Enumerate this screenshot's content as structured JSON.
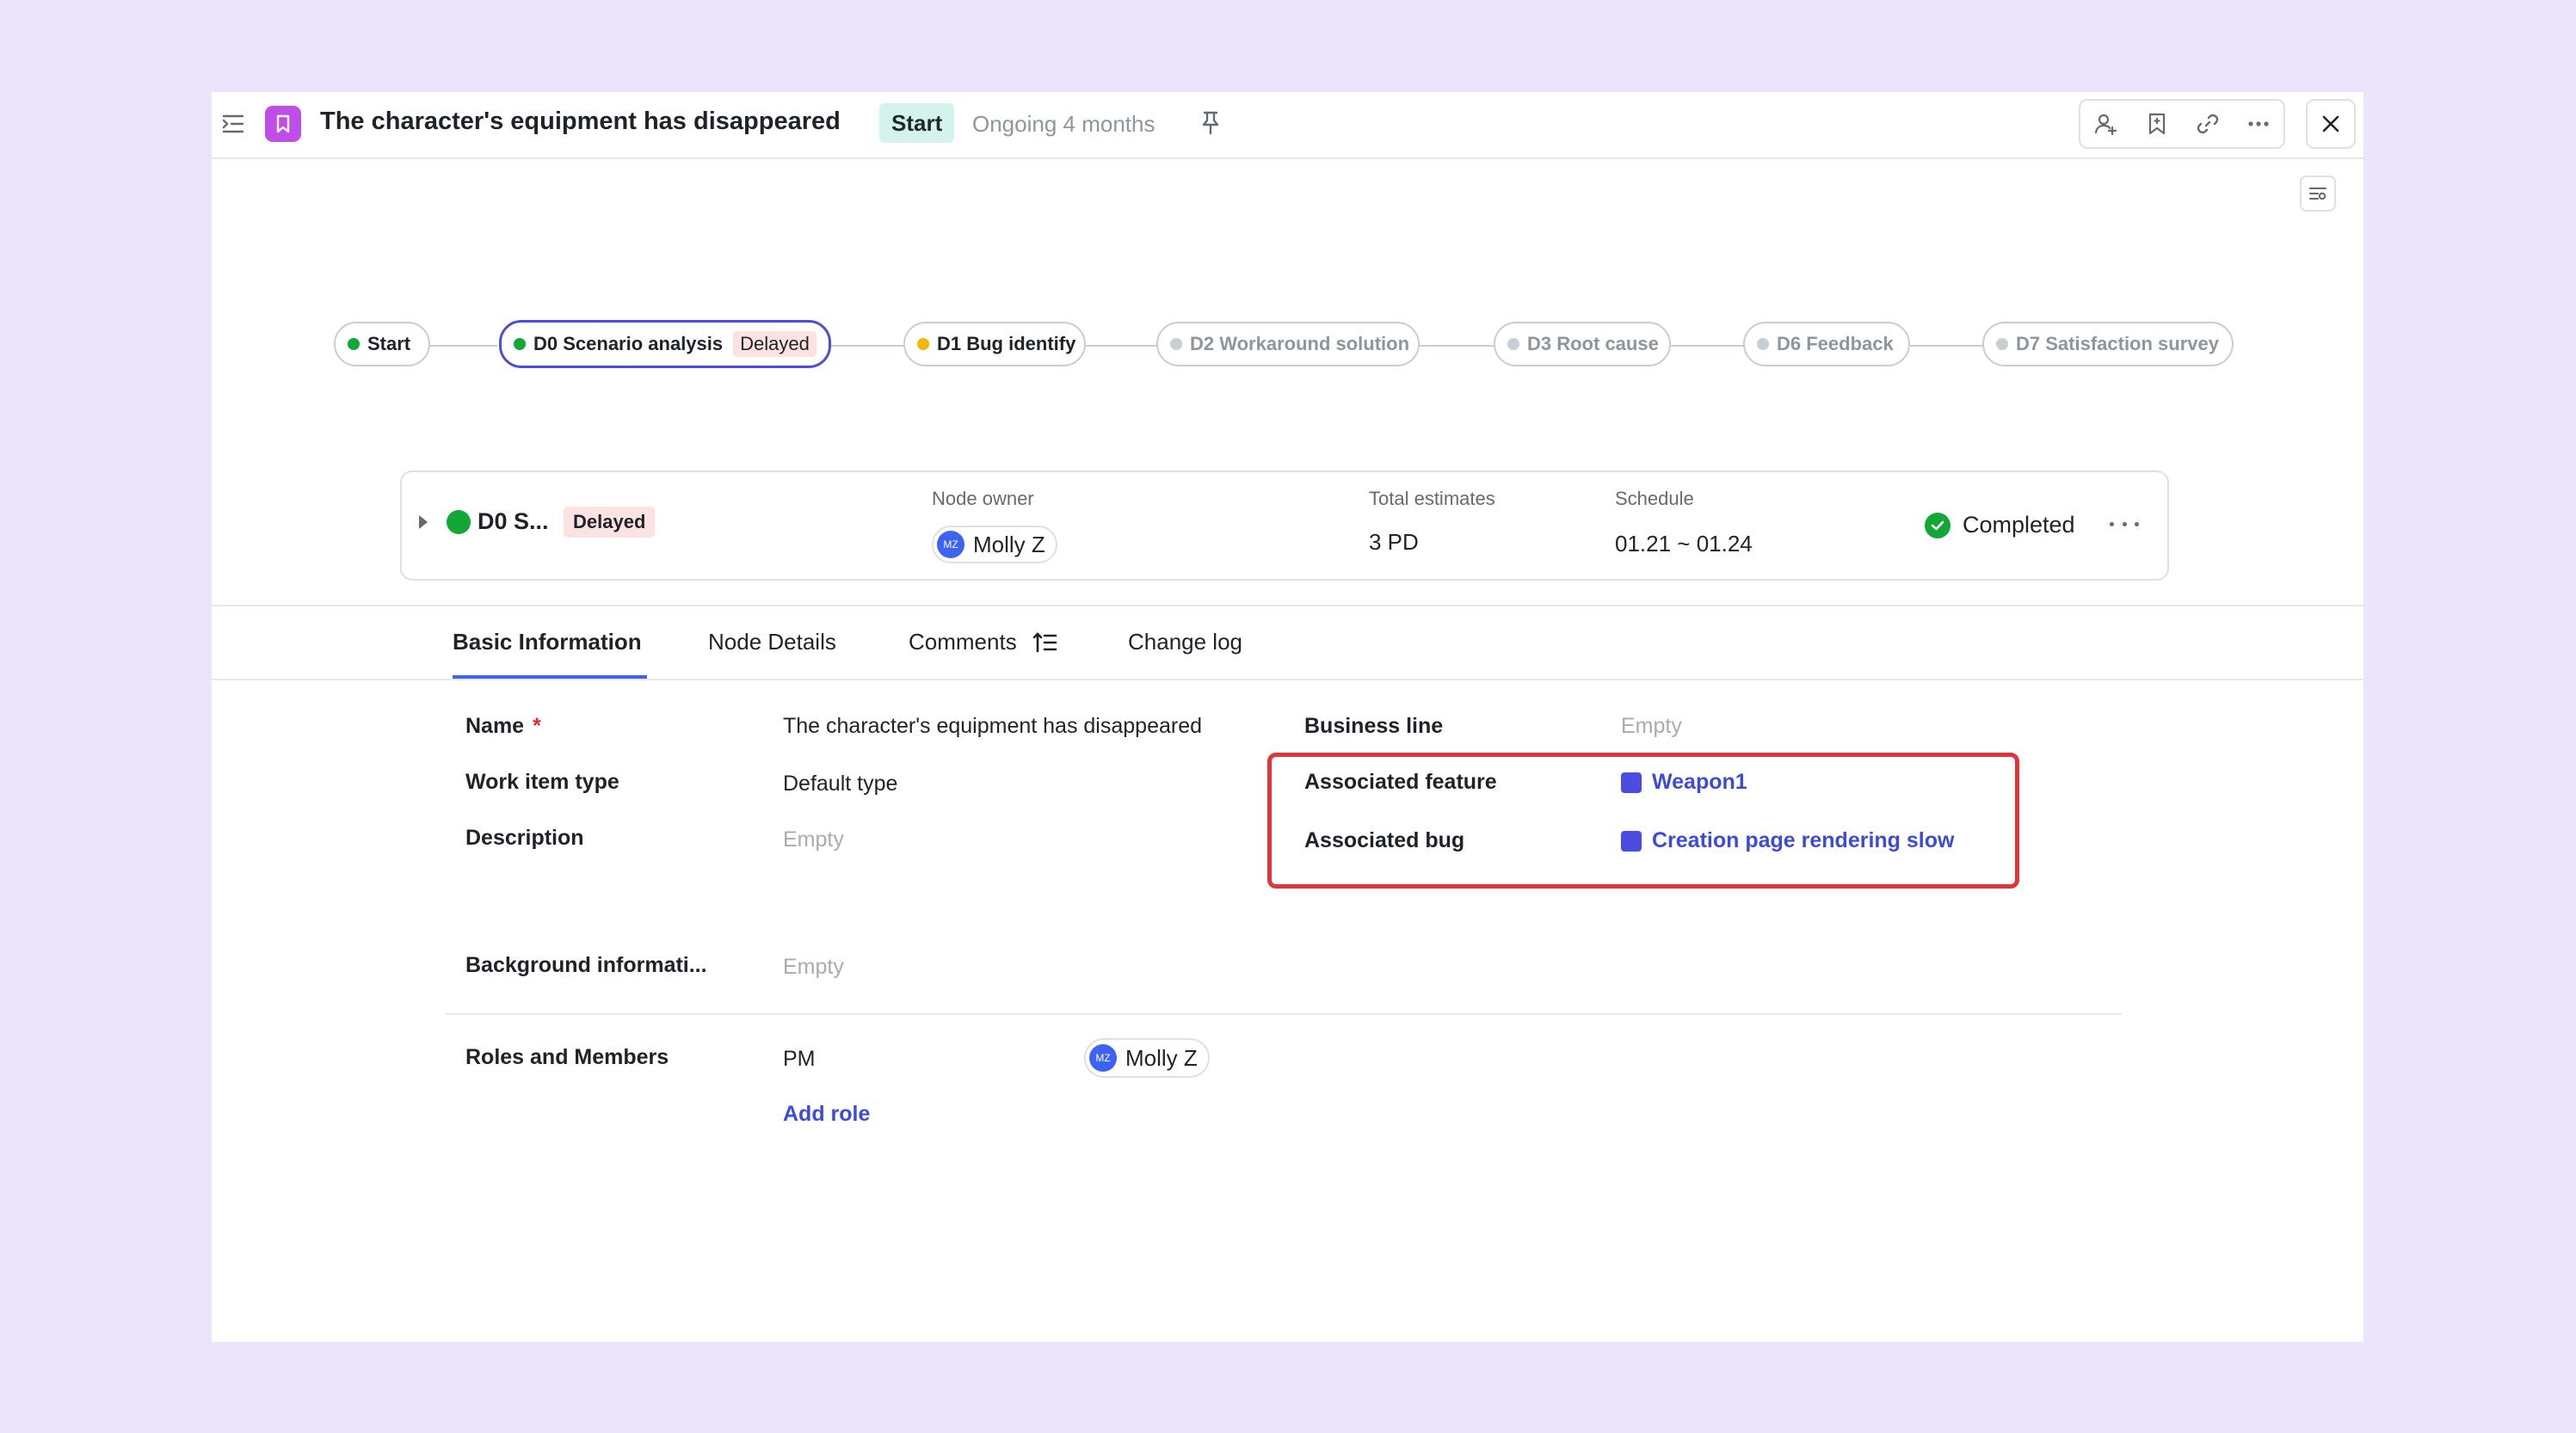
{
  "header": {
    "title": "The character's equipment has disappeared",
    "status": "Start",
    "ongoing": "Ongoing 4 months",
    "icons": [
      "collapse-icon",
      "bookmark-icon",
      "pin-icon",
      "share-users-icon",
      "save-bookmark-icon",
      "link-icon",
      "more-icon",
      "close-icon"
    ]
  },
  "pipeline": {
    "nodes": [
      {
        "label": "Start",
        "dot": "#11a836",
        "state": "done"
      },
      {
        "label": "D0 Scenario analysis",
        "dot": "#11a836",
        "state": "active",
        "badge": "Delayed"
      },
      {
        "label": "D1 Bug identify",
        "dot": "#f5b800",
        "state": "current"
      },
      {
        "label": "D2 Workaround solution",
        "dot": "#c9cdd4",
        "state": "pending"
      },
      {
        "label": "D3 Root cause",
        "dot": "#c9cdd4",
        "state": "pending"
      },
      {
        "label": "D6 Feedback",
        "dot": "#c9cdd4",
        "state": "pending"
      },
      {
        "label": "D7 Satisfaction survey",
        "dot": "#c9cdd4",
        "state": "pending"
      }
    ]
  },
  "node_card": {
    "name": "D0 S...",
    "badge": "Delayed",
    "owner_label": "Node owner",
    "owner_initials": "MZ",
    "owner_name": "Molly Z",
    "estimates_label": "Total estimates",
    "estimates_value": "3 PD",
    "schedule_label": "Schedule",
    "schedule_value": "01.21 ~ 01.24",
    "status": "Completed"
  },
  "tabs": [
    {
      "label": "Basic Information",
      "active": true
    },
    {
      "label": "Node Details",
      "active": false
    },
    {
      "label": "Comments",
      "active": false
    },
    {
      "label": "Change log",
      "active": false
    }
  ],
  "fields": {
    "name_label": "Name",
    "name_required": "*",
    "name_value": "The character's equipment has disappeared",
    "type_label": "Work item type",
    "type_value": "Default type",
    "description_label": "Description",
    "description_value": "Empty",
    "background_label": "Background informati...",
    "background_value": "Empty",
    "business_label": "Business line",
    "business_value": "Empty",
    "feature_label": "Associated feature",
    "feature_value": "Weapon1",
    "bug_label": "Associated bug",
    "bug_value": "Creation page rendering slow"
  },
  "roles": {
    "label": "Roles and Members",
    "role": "PM",
    "member_initials": "MZ",
    "member_name": "Molly Z",
    "add_role": "Add role"
  },
  "colors": {
    "accent": "#4d4ce0",
    "link": "#3d4bdb",
    "success": "#11a836",
    "highlight": "#e3343c",
    "delayed_bg": "#fde2e2"
  }
}
